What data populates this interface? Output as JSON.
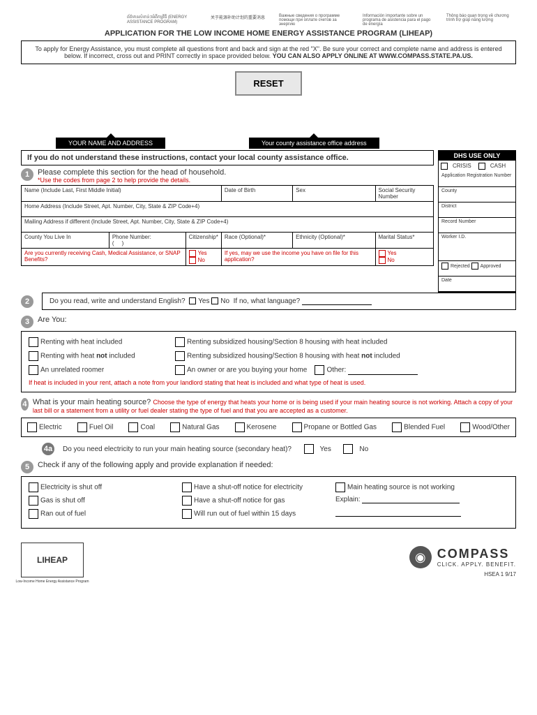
{
  "langs": [
    "ព័ត៌មានសំខាន់ៗអំពីកម្មវិធី (ENERGY ASSISTANCE PROGRAM)",
    "关于能源补助计划的重要消息",
    "Важные сведения о программе помощи при оплате счетов за энергию",
    "Información importante sobre un programa de asistencia para el pago de energía",
    "Thông báo quan trọng về chương trình trợ giúp năng lượng"
  ],
  "title": "APPLICATION FOR THE LOW INCOME HOME ENERGY ASSISTANCE PROGRAM (LIHEAP)",
  "instr": "To apply for Energy Assistance, you must complete all questions front and back and sign at the red \"X\". Be sure your correct and complete name and address is entered below. If incorrect, cross out and PRINT correctly in space provided below. ",
  "instr_bold": "YOU CAN ALSO APPLY ONLINE AT WWW.COMPASS.STATE.PA.US.",
  "reset": "RESET",
  "tab1": "YOUR NAME AND ADDRESS",
  "tab2": "Your county assistance office address",
  "dhs": {
    "title": "DHS USE ONLY",
    "crisis": "CRISIS",
    "cash": "CASH",
    "appreg": "Application Registration Number",
    "county": "County",
    "district": "District",
    "record": "Record Number",
    "worker": "Worker I.D.",
    "rejected": "Rejected",
    "approved": "Approved",
    "date": "Date"
  },
  "notice": "If you do not understand these instructions, contact your local county assistance office.",
  "s1": {
    "head": "Please complete this section for the head of household.",
    "sub": "*Use the codes from page 2 to help provide the details.",
    "name": "Name (Include Last, First Middle Initial)",
    "dob": "Date of Birth",
    "sex": "Sex",
    "ssn": "Social Security Number",
    "home": "Home Address (Include Street, Apt. Number, City, State & ZIP Code+4)",
    "mail": "Mailing Address if different (Include Street, Apt. Number, City, State & ZIP Code+4)",
    "county": "County You Live In",
    "phone": "Phone Number:",
    "citizen": "Citizenship*",
    "race": "Race (Optional)*",
    "ethnic": "Ethnicity (Optional)*",
    "marital": "Marital Status*",
    "snap": "Are you currently receiving Cash, Medical Assistance, or SNAP Benefits?",
    "yes": "Yes",
    "no": "No",
    "income": "If yes, may we use the income you have on file for this application?"
  },
  "s2": {
    "q": "Do you read, write and understand English?",
    "yes": "Yes",
    "no": "No",
    "lang": "If no, what language?"
  },
  "s3": {
    "q": "Are You:",
    "o1": "Renting with heat included",
    "o2": "Renting subsidized housing/Section 8 housing with heat included",
    "o3": "Renting with heat not included",
    "o4": "Renting subsidized housing/Section 8 housing with heat not included",
    "o5": "An unrelated roomer",
    "o6": "An owner or are you buying your home",
    "other": "Other:",
    "note": "If heat is included in your rent, attach a note from your landlord stating that heat is included and what type of heat is used."
  },
  "s4": {
    "q": "What is your main heating source? ",
    "sub": "Choose the type of energy that heats your home or is being used if your main heating source is not working. Attach a copy of your last bill or a statement from a utility or fuel dealer stating the type of fuel and that you are accepted as a customer.",
    "opts": [
      "Electric",
      "Fuel Oil",
      "Coal",
      "Natural Gas",
      "Kerosene",
      "Propane or Bottled Gas",
      "Blended Fuel",
      "Wood/Other"
    ],
    "a": "Do you need electricity to run your main heating source (secondary heat)?",
    "yes": "Yes",
    "no": "No"
  },
  "s5": {
    "q": "Check if any of the following apply and provide explanation if needed:",
    "o1": "Electricity is shut off",
    "o2": "Have a shut-off notice for electricity",
    "o3": "Main heating source is not working",
    "o4": "Gas is shut off",
    "o5": "Have a shut-off notice for gas",
    "explain": "Explain:",
    "o6": "Ran out of fuel",
    "o7": "Will run out of fuel within 15 days"
  },
  "footer": {
    "liheap": "LIHEAP",
    "compass": "COMPASS",
    "compass_sub": "CLICK. APPLY. BENEFIT.",
    "id": "HSEA 1   9/17"
  }
}
